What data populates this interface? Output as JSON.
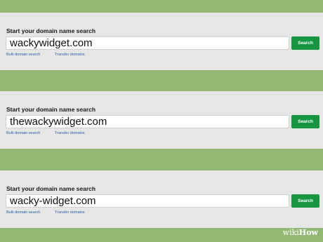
{
  "panels": [
    {
      "title": "Start your domain name search",
      "input_value": "wackywidget.com",
      "search_label": "Search",
      "bulk_label": "Bulk domain search",
      "transfer_label": "Transfer domains"
    },
    {
      "title": "Start your domain name search",
      "input_value": "thewackywidget.com",
      "search_label": "Search",
      "bulk_label": "Bulk domain search",
      "transfer_label": "Transfer domains"
    },
    {
      "title": "Start your domain name search",
      "input_value": "wacky-widget.com",
      "search_label": "Search",
      "bulk_label": "Bulk domain search",
      "transfer_label": "Transfer domains"
    }
  ],
  "watermark": {
    "wiki": "wiki",
    "how": "How"
  },
  "colors": {
    "background_green": "#93b873",
    "panel_gray": "#e6e6e6",
    "search_button_green": "#17963f",
    "link_blue": "#2b5da8"
  }
}
